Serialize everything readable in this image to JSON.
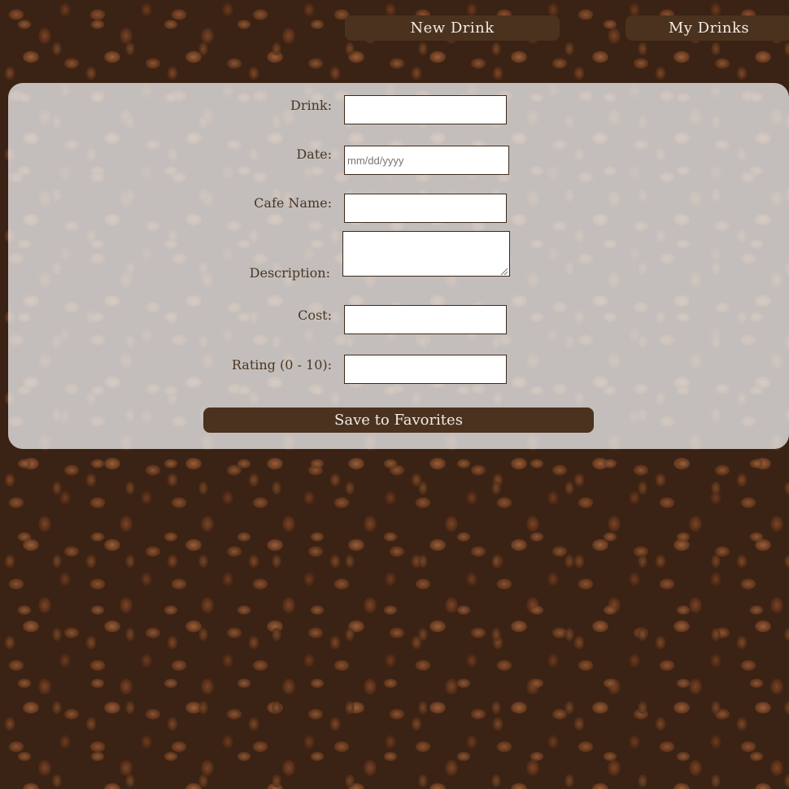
{
  "nav": {
    "new_drink": "New Drink",
    "my_drinks": "My Drinks"
  },
  "form": {
    "drink_label": "Drink:",
    "drink_value": "",
    "date_label": "Date:",
    "date_placeholder": "mm/dd/yyyy",
    "cafe_label": "Cafe Name:",
    "cafe_value": "",
    "description_label": "Description:",
    "description_value": "",
    "cost_label": "Cost:",
    "cost_value": "",
    "rating_label": "Rating (0 - 10):",
    "rating_value": "",
    "save_label": "Save to Favorites"
  },
  "colors": {
    "button_bg": "#4a321f",
    "panel_bg": "#ebebeb",
    "label_text": "#4a3625"
  }
}
